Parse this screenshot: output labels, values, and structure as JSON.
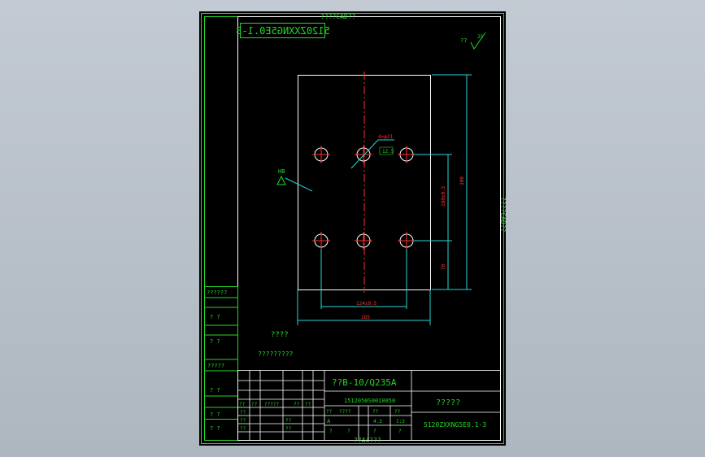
{
  "sheet": {
    "header_text": "????CAD??",
    "side_text": "????CAD??",
    "footer_text": "??A4???",
    "mirrored_code": "5120ZXXNG5E0.1-3"
  },
  "roughness": {
    "label": "??",
    "value": "25"
  },
  "annotations": {
    "top_hole_spec": "4×φ21",
    "hole_depth": "12.5",
    "hardness_mark": "HB",
    "dim_width_inner": "124±0.5",
    "dim_width_outer": "185",
    "dim_height_total": "300",
    "dim_height_inner": "180±0.5",
    "dim_height_bottom": "70"
  },
  "notes": {
    "title": "????",
    "body": "?????????"
  },
  "left_table": [
    "??????",
    "? ?",
    "? ?",
    "?????",
    "? ?",
    "? ?",
    "? ?"
  ],
  "title_block": {
    "material": "??B-10/Q235A",
    "part_code": "1512050S0010050",
    "part_name": "?????",
    "drawing_no": "5120ZXXNG5E0.1-3",
    "left_grid": [
      [
        "??",
        "??",
        "?????",
        "??",
        "??"
      ],
      [
        "??",
        "",
        "",
        "",
        ""
      ],
      [
        "??",
        "",
        "??",
        "",
        ""
      ],
      [
        "??",
        "",
        "??",
        "",
        ""
      ]
    ],
    "right_grid": [
      [
        "??",
        "????",
        "??",
        "??"
      ],
      [
        "A",
        "",
        "4.3",
        "1:2"
      ],
      [
        "?",
        "?",
        "?",
        "?"
      ]
    ]
  },
  "colors": {
    "frame": "#26d626",
    "outline": "#ffffff",
    "centerline": "#ff3030",
    "dimension": "#26d6d6"
  }
}
